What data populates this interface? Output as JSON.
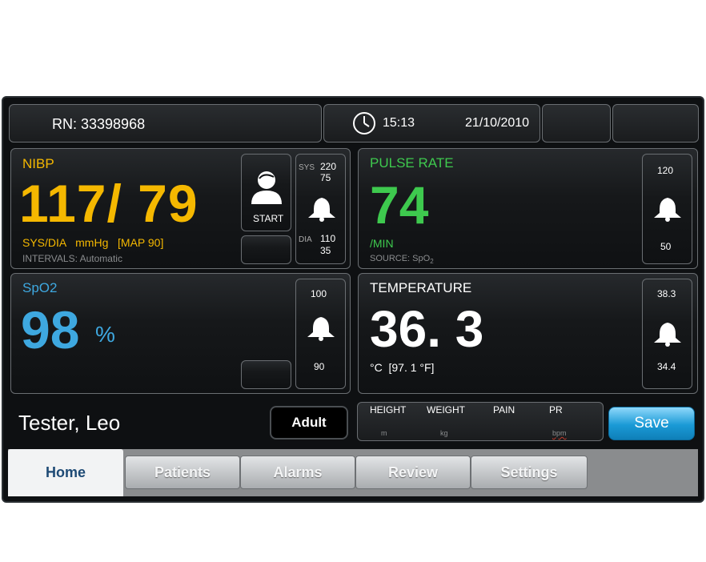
{
  "header": {
    "rn": "RN: 33398968",
    "time": "15:13",
    "date": "21/10/2010"
  },
  "nibp": {
    "title": "NIBP",
    "value": "117/ 79",
    "units": "SYS/DIA   mmHg   [MAP 90]",
    "intervals": "INTERVALS: Automatic",
    "start_label": "START",
    "sys_label": "SYS",
    "sys_high": "220",
    "sys_low": "75",
    "dia_label": "DIA",
    "dia_high": "110",
    "dia_low": "35"
  },
  "pulse": {
    "title": "PULSE RATE",
    "value": "74",
    "unit": "/MIN",
    "source": "SOURCE: SpO",
    "source_sub": "2",
    "alarm_high": "120",
    "alarm_low": "50"
  },
  "spo2": {
    "title": "SpO2",
    "value": "98",
    "unit": "%",
    "alarm_high": "100",
    "alarm_low": "90"
  },
  "temperature": {
    "title": "TEMPERATURE",
    "value": "36. 3",
    "unit": "°C  [97. 1 °F]",
    "alarm_high": "38.3",
    "alarm_low": "34.4"
  },
  "patient": {
    "name": "Tester, Leo",
    "type_button": "Adult"
  },
  "manual": {
    "height_label": "HEIGHT",
    "weight_label": "WEIGHT",
    "pain_label": "PAIN",
    "pr_label": "PR",
    "height_unit": "m",
    "weight_unit": "kg",
    "pr_unit": "bpm"
  },
  "save_button": "Save",
  "tabs": [
    {
      "label": "Home"
    },
    {
      "label": "Patients"
    },
    {
      "label": "Alarms"
    },
    {
      "label": "Review"
    },
    {
      "label": "Settings"
    }
  ],
  "colors": {
    "nibp": "#f5b800",
    "pulse": "#3ec94e",
    "spo2": "#3ea8e0",
    "temperature": "#ffffff",
    "save": "#1a9ad6"
  }
}
